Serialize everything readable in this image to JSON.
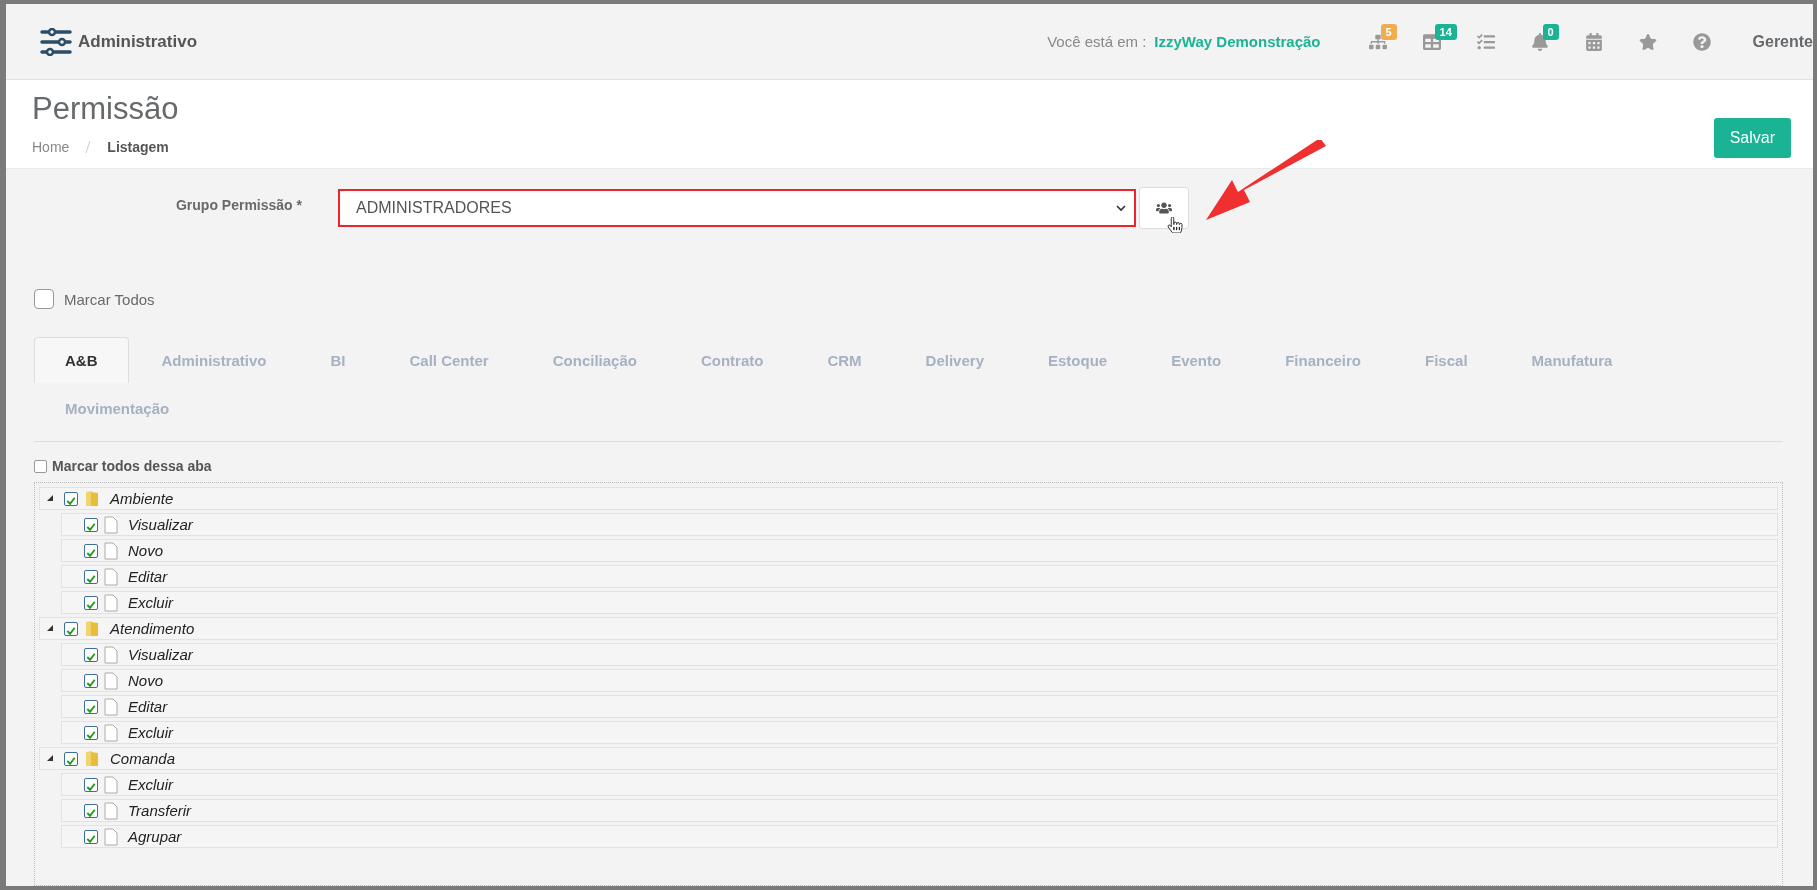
{
  "header": {
    "module": "Administrativo",
    "location_label": "Você está em :",
    "location_value": "IzzyWay Demonstração",
    "icons": [
      {
        "kind": "sitemap",
        "badge": "5",
        "color": "#f0ad4e"
      },
      {
        "kind": "table",
        "badge": "14",
        "color": "#1ab394"
      },
      {
        "kind": "tasks"
      },
      {
        "kind": "bell",
        "badge": "0",
        "color": "#1ab394"
      },
      {
        "kind": "calendar"
      },
      {
        "kind": "star"
      },
      {
        "kind": "help"
      }
    ],
    "user": "Gerente"
  },
  "page": {
    "title": "Permissão",
    "breadcrumb": [
      {
        "label": "Home",
        "selected": false
      },
      {
        "label": "Listagem",
        "selected": true
      }
    ],
    "save_button": "Salvar"
  },
  "form": {
    "group_label": "Grupo Permissão *",
    "group_value": "ADMINISTRADORES",
    "mark_all": {
      "label": "Marcar Todos",
      "checked": false
    }
  },
  "tabs": [
    {
      "label": "A&B",
      "selected": true
    },
    {
      "label": "Administrativo",
      "selected": false
    },
    {
      "label": "BI",
      "selected": false
    },
    {
      "label": "Call Center",
      "selected": false
    },
    {
      "label": "Conciliação",
      "selected": false
    },
    {
      "label": "Contrato",
      "selected": false
    },
    {
      "label": "CRM",
      "selected": false
    },
    {
      "label": "Delivery",
      "selected": false
    },
    {
      "label": "Estoque",
      "selected": false
    },
    {
      "label": "Evento",
      "selected": false
    },
    {
      "label": "Financeiro",
      "selected": false
    },
    {
      "label": "Fiscal",
      "selected": false
    },
    {
      "label": "Manufatura",
      "selected": false
    },
    {
      "label": "Movimentação",
      "selected": false
    }
  ],
  "tab_mark_all": {
    "label": "Marcar todos dessa aba",
    "checked": false
  },
  "tree": [
    {
      "label": "Ambiente",
      "checked": true,
      "expanded": true,
      "children": [
        {
          "label": "Visualizar",
          "checked": true
        },
        {
          "label": "Novo",
          "checked": true
        },
        {
          "label": "Editar",
          "checked": true
        },
        {
          "label": "Excluir",
          "checked": true
        }
      ]
    },
    {
      "label": "Atendimento",
      "checked": true,
      "expanded": true,
      "children": [
        {
          "label": "Visualizar",
          "checked": true
        },
        {
          "label": "Novo",
          "checked": true
        },
        {
          "label": "Editar",
          "checked": true
        },
        {
          "label": "Excluir",
          "checked": true
        }
      ]
    },
    {
      "label": "Comanda",
      "checked": true,
      "expanded": true,
      "children": [
        {
          "label": "Excluir",
          "checked": true
        },
        {
          "label": "Transferir",
          "checked": true
        },
        {
          "label": "Agrupar",
          "checked": true
        }
      ]
    }
  ]
}
